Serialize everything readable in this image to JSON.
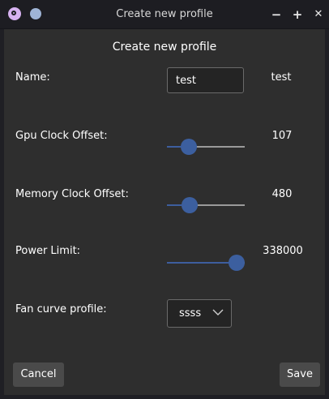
{
  "window": {
    "title": "Create new profile",
    "buttons": {
      "minimize": "−",
      "maximize": "+",
      "close": "✕"
    }
  },
  "form": {
    "heading": "Create new profile",
    "name": {
      "label": "Name:",
      "input_value": "test",
      "display_value": "test"
    },
    "gpu_clock_offset": {
      "label": "Gpu Clock Offset:",
      "value": "107",
      "slider_fraction": 0.28
    },
    "memory_clock_offset": {
      "label": "Memory Clock Offset:",
      "value": "480",
      "slider_fraction": 0.29
    },
    "power_limit": {
      "label": "Power Limit:",
      "value": "338000",
      "slider_fraction": 0.9
    },
    "fan_curve_profile": {
      "label": "Fan curve profile:",
      "selected": "ssss"
    }
  },
  "actions": {
    "cancel_label": "Cancel",
    "save_label": "Save"
  },
  "colors": {
    "accent": "#3c5f9f",
    "background": "#2e2e2e",
    "titlebar": "#1d1d22"
  },
  "icons": {
    "app": "app-logo-icon",
    "sticky": "circle-icon",
    "dropdown": "chevron-down-icon"
  }
}
